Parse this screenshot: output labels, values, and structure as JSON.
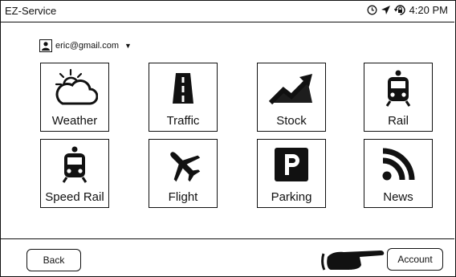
{
  "header": {
    "app_title": "EZ-Service",
    "time": "4:20 PM",
    "status_icons": [
      "alarm-clock-icon",
      "location-arrow-icon",
      "lock-rotation-icon"
    ]
  },
  "account": {
    "email": "eric@gmail.com",
    "dropdown_icon": "caret-down-icon"
  },
  "tiles": [
    {
      "label": "Weather",
      "icon": "weather-icon"
    },
    {
      "label": "Traffic",
      "icon": "road-icon"
    },
    {
      "label": "Stock",
      "icon": "stock-chart-icon"
    },
    {
      "label": "Rail",
      "icon": "train-icon"
    },
    {
      "label": "Speed Rail",
      "icon": "train-icon"
    },
    {
      "label": "Flight",
      "icon": "airplane-icon"
    },
    {
      "label": "Parking",
      "icon": "parking-icon"
    },
    {
      "label": "News",
      "icon": "rss-icon"
    }
  ],
  "footer": {
    "back_label": "Back",
    "account_label": "Account",
    "pointer_icon": "pointing-hand-icon"
  }
}
